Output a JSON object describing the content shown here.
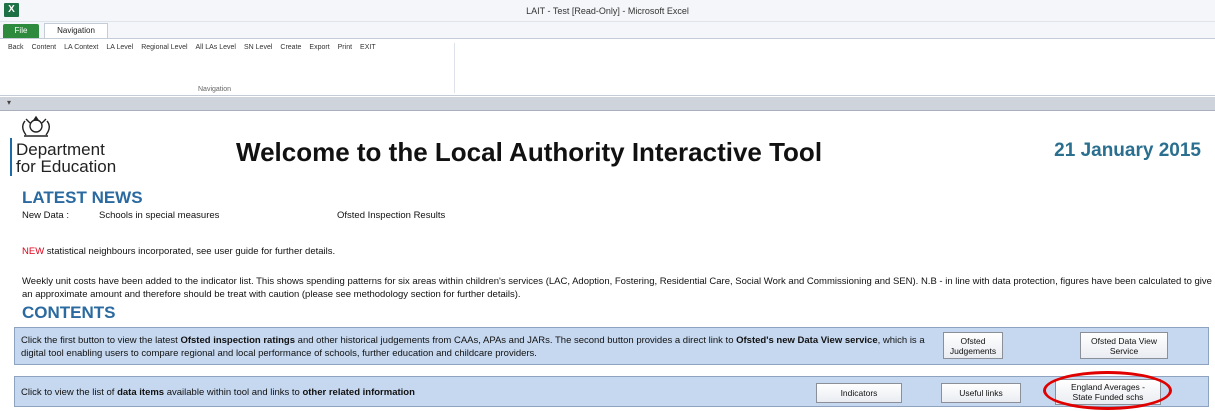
{
  "window": {
    "title": "LAIT - Test  [Read-Only]  -  Microsoft Excel",
    "app_icon": "excel-icon"
  },
  "tabs": {
    "file": "File",
    "navigation": "Navigation"
  },
  "ribbon": {
    "buttons": [
      "Back",
      "Content",
      "LA Context",
      "LA Level",
      "Regional Level",
      "All LAs Level",
      "SN Level",
      "Create",
      "Export",
      "Print",
      "EXIT"
    ],
    "group_label": "Navigation"
  },
  "sheet": {
    "org_line1": "Department",
    "org_line2": "for Education",
    "title": "Welcome to the Local Authority Interactive Tool",
    "date": "21 January 2015",
    "latest_news": {
      "heading": "LATEST NEWS",
      "label": "New Data :",
      "item1": "Schools in special measures",
      "item2": "Ofsted Inspection Results"
    },
    "new_tag": "NEW",
    "new_text": " statistical neighbours incorporated, see user guide for further details.",
    "weekly_text": "Weekly unit costs have been added to the indicator list.  This shows spending patterns for six areas within children's services (LAC, Adoption, Fostering, Residential Care, Social Work and Commissioning and SEN).  N.B - in line with data protection, figures have been calculated to give an approximate amount and therefore should be treat with caution (please see methodology section for further details).",
    "contents": {
      "heading": "CONTENTS",
      "box1": {
        "t1": "Click the first button to view the latest ",
        "b1": "Ofsted inspection ratings",
        "t2": " and other historical judgements from CAAs, APAs and JARs.  The second button provides a direct link to ",
        "b2": "Ofsted's new Data View service",
        "t3": ", which is a digital tool enabling users to compare regional and local performance of schools, further education and childcare providers.",
        "btn_ofsted_line1": "Ofsted",
        "btn_ofsted_line2": "Judgements",
        "btn_dataview_line1": "Ofsted Data View",
        "btn_dataview_line2": "Service"
      },
      "box2": {
        "t1": "Click to view the list of ",
        "b1": "data items",
        "t2": " available within tool and links to ",
        "b2": "other related information",
        "btn_indicators": "Indicators",
        "btn_useful": "Useful links",
        "btn_england_line1": "England Averages -",
        "btn_england_line2": "State Funded schs"
      }
    }
  },
  "colors": {
    "heading": "#2a6aa0",
    "date": "#2a6f8f",
    "new": "#e2001a",
    "box_fill": "#c6d8ef",
    "highlight_circle": "#e00000"
  }
}
